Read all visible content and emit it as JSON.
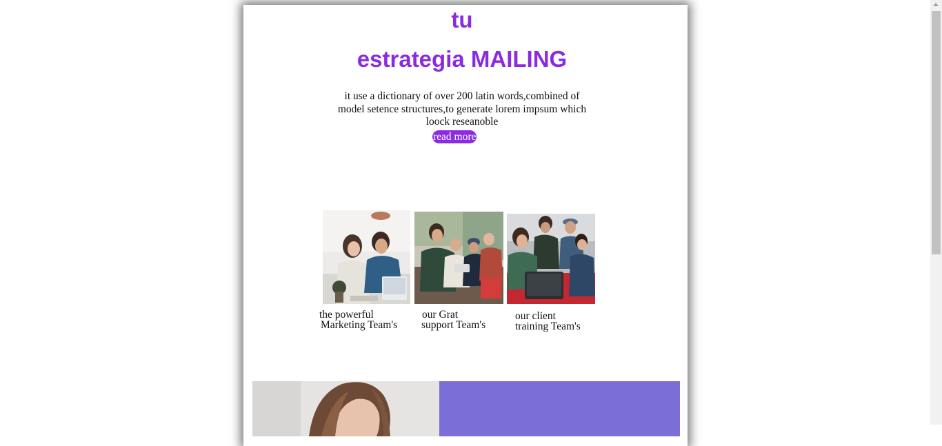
{
  "header": {
    "brand_top": "tu",
    "brand_main": "estrategia MAILING"
  },
  "intro": {
    "text": "it use a dictionary of over 200 latin words,combined of model setence structures,to generate lorem impsum which loock reseanoble",
    "read_more_label": "read more"
  },
  "teams": [
    {
      "line1": "the powerful",
      "line2": "Marketing Team's",
      "image": "two-people-laptop-photo"
    },
    {
      "line1": "our Grat",
      "line2": "support Team's",
      "image": "group-on-couch-photo"
    },
    {
      "line1": "our client",
      "line2": "training Team's",
      "image": "group-with-laptop-photo"
    }
  ],
  "banner": {
    "image": "woman-portrait-photo"
  },
  "colors": {
    "accent": "#8a2be2",
    "banner_panel": "#7b6fd6",
    "text": "#111111",
    "page_background": "#ffffff"
  }
}
